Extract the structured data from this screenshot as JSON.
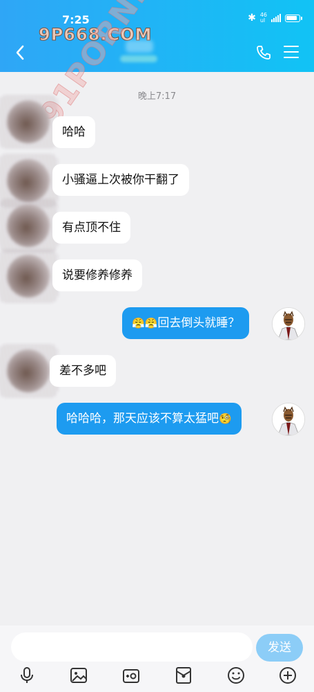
{
  "status_bar": {
    "time": "7:25",
    "network_top": "46",
    "network_bottom": "ul"
  },
  "watermarks": {
    "top": "9P668.COM",
    "diagonal": "91PORN.COM"
  },
  "header": {
    "icons": [
      "back-icon",
      "phone-icon",
      "menu-icon"
    ]
  },
  "chat": {
    "timestamp": "晚上7:17",
    "messages": [
      {
        "side": "in",
        "text": "哈哈"
      },
      {
        "side": "in",
        "text": "小骚逼上次被你干翻了"
      },
      {
        "side": "in",
        "text": "有点顶不住"
      },
      {
        "side": "in",
        "text": "说要修养修养"
      },
      {
        "side": "out",
        "emoji": "😤😤",
        "text": "回去倒头就睡？"
      },
      {
        "side": "in",
        "text": "差不多吧"
      },
      {
        "side": "out",
        "text": "哈哈哈，那天应该不算太猛吧",
        "emoji": "🧐"
      }
    ]
  },
  "input": {
    "placeholder": "",
    "send_label": "发送"
  },
  "toolbar": {
    "icons": [
      "microphone-icon",
      "image-icon",
      "camera-icon",
      "red-packet-icon",
      "emoji-icon",
      "plus-icon"
    ]
  },
  "colors": {
    "header_start": "#2fa6f6",
    "header_end": "#11c3f5",
    "outgoing_bubble": "#1d9bf0",
    "send_button": "#8ccdf7"
  }
}
